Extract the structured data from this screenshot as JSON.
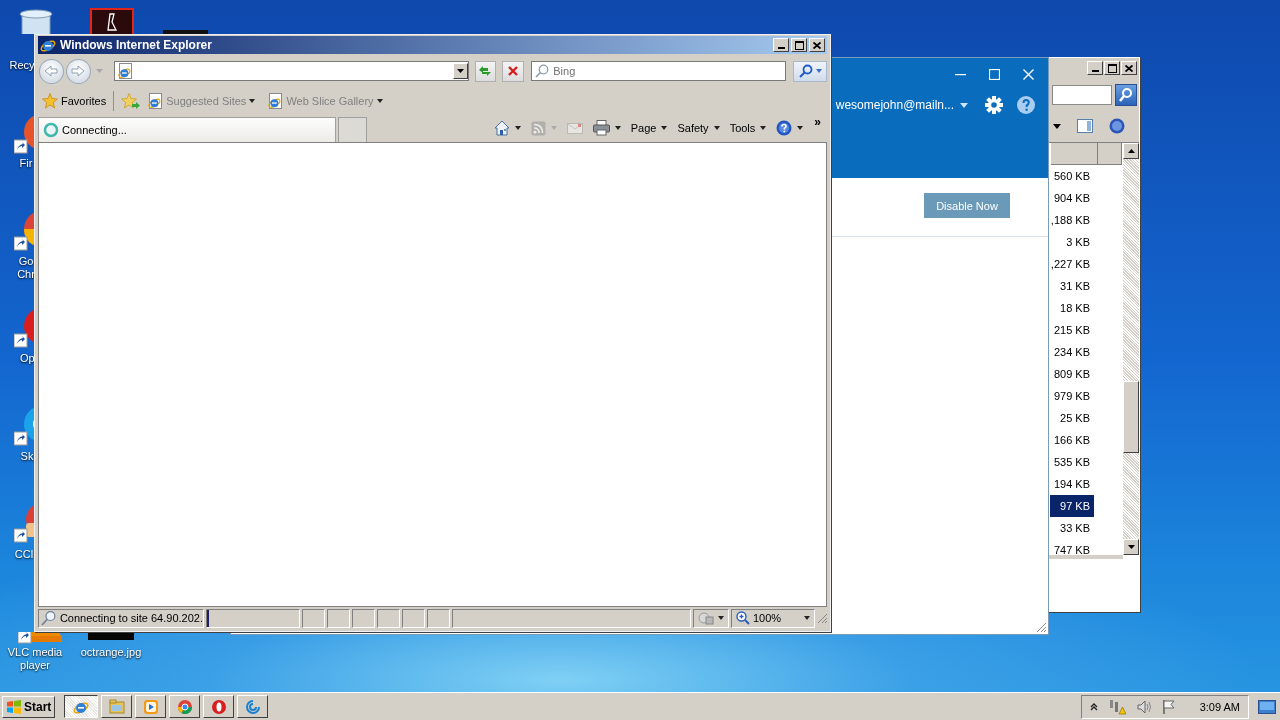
{
  "desktop_icons": [
    {
      "kind": "trash",
      "label": "Recy"
    },
    {
      "kind": "fox",
      "label": "Fir"
    },
    {
      "kind": "chrome",
      "label": "Go Chr"
    },
    {
      "kind": "opera",
      "label": "Op"
    },
    {
      "kind": "skype",
      "label": "Sk"
    },
    {
      "kind": "cleaner",
      "label": "CCl"
    },
    {
      "kind": "vlc",
      "label": "VLC media player"
    },
    {
      "kind": "image",
      "label": "octrange.jpg"
    },
    {
      "kind": "pdf"
    },
    {
      "kind": "dark"
    }
  ],
  "file_window": {
    "rows": [
      {
        "size": "560 KB",
        "selected": false
      },
      {
        "size": "904 KB",
        "selected": false
      },
      {
        "size": ",188 KB",
        "selected": false
      },
      {
        "size": "3 KB",
        "selected": false
      },
      {
        "size": ",227 KB",
        "selected": false
      },
      {
        "size": "31 KB",
        "selected": false
      },
      {
        "size": "18 KB",
        "selected": false
      },
      {
        "size": "215 KB",
        "selected": false
      },
      {
        "size": "234 KB",
        "selected": false
      },
      {
        "size": "809 KB",
        "selected": false
      },
      {
        "size": "979 KB",
        "selected": false
      },
      {
        "size": "25 KB",
        "selected": false
      },
      {
        "size": "166 KB",
        "selected": false
      },
      {
        "size": "535 KB",
        "selected": false
      },
      {
        "size": "194 KB",
        "selected": false
      },
      {
        "size": "97 KB",
        "selected": true
      },
      {
        "size": "33 KB",
        "selected": false
      },
      {
        "size": "747 KB",
        "selected": false
      }
    ]
  },
  "mail_window": {
    "account": "wesomejohn@mailn...",
    "button": "Disable Now"
  },
  "ie_window": {
    "title": "Windows Internet Explorer",
    "search": {
      "placeholder": "Bing"
    },
    "favorites": "Favorites",
    "links": [
      {
        "label": "Suggested Sites",
        "disabled": true
      },
      {
        "label": "Web Slice Gallery",
        "disabled": true
      }
    ],
    "tabs": [
      {
        "label": "Connecting...",
        "selected": true
      }
    ],
    "commands": [
      {
        "kind": "home",
        "disabled": false
      },
      {
        "kind": "feeds",
        "disabled": true
      },
      {
        "kind": "mail",
        "disabled": true
      },
      {
        "kind": "print",
        "disabled": false
      },
      {
        "kind": "menu",
        "label": "Page"
      },
      {
        "kind": "menu",
        "label": "Safety"
      },
      {
        "kind": "menu",
        "label": "Tools"
      },
      {
        "kind": "help",
        "disabled": false
      }
    ],
    "overflow": "»",
    "status_bar": {
      "text": "Connecting to site 64.90.202.",
      "progress": {
        "level": 0.02
      },
      "zoom": "100%"
    }
  },
  "taskbar": {
    "start": "Start",
    "apps": [
      {
        "kind": "ie",
        "selected": true
      },
      {
        "kind": "folder",
        "selected": false
      },
      {
        "kind": "media",
        "selected": false
      },
      {
        "kind": "chrome",
        "selected": false
      },
      {
        "kind": "opera",
        "selected": false
      },
      {
        "kind": "swirl",
        "selected": false
      }
    ],
    "clock": "3:09 AM"
  }
}
